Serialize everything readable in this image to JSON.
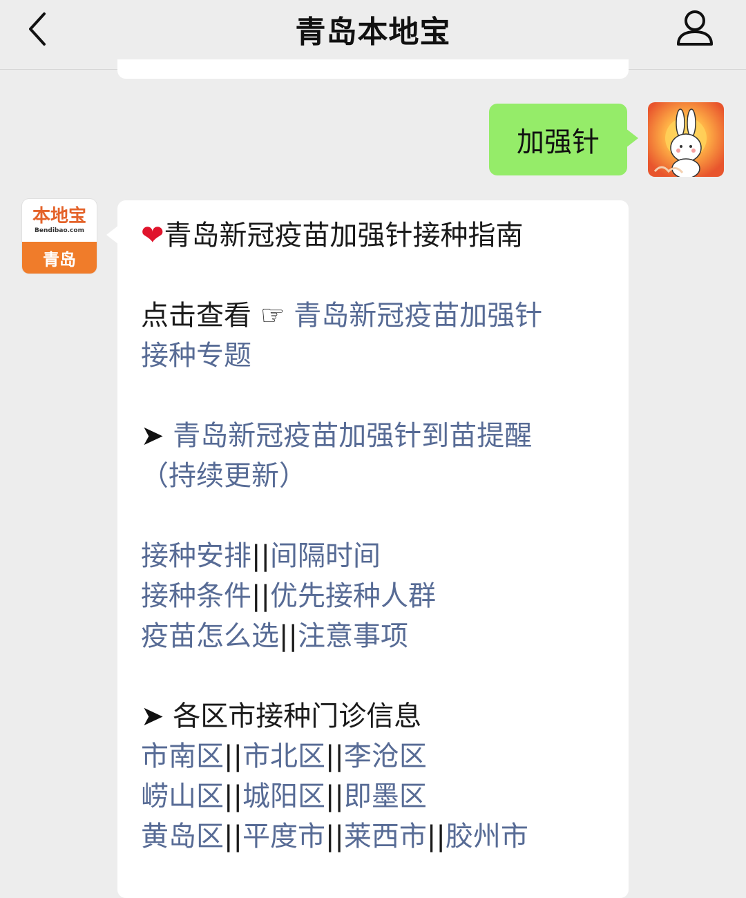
{
  "header": {
    "title": "青岛本地宝"
  },
  "chat": {
    "sent_message": "加强针",
    "account_avatar": {
      "logo_text": "本地宝",
      "domain_text": "Bendibao.com",
      "city_text": "青岛"
    },
    "reply": {
      "heart_glyph": "❤",
      "headline": "青岛新冠疫苗加强针接种指南",
      "view_prefix": "点击查看 ☞",
      "special_topic_line1": "青岛新冠疫苗加强针",
      "special_topic_line2": "接种专题",
      "arrow_glyph": "➤",
      "reminder_line1": "青岛新冠疫苗加强针到苗提醒",
      "reminder_line2": "（持续更新）",
      "separator": "||",
      "topic_links": [
        [
          "接种安排",
          "间隔时间"
        ],
        [
          "接种条件",
          "优先接种人群"
        ],
        [
          "疫苗怎么选",
          "注意事项"
        ]
      ],
      "districts_heading": "各区市接种门诊信息",
      "district_links": [
        [
          "市南区",
          "市北区",
          "李沧区"
        ],
        [
          "崂山区",
          "城阳区",
          "即墨区"
        ],
        [
          "黄岛区",
          "平度市",
          "莱西市",
          "胶州市"
        ]
      ]
    }
  },
  "colors": {
    "background": "#ededed",
    "sent_bubble": "#95ec69",
    "link": "#576b95",
    "brand_orange": "#f07c2a"
  }
}
